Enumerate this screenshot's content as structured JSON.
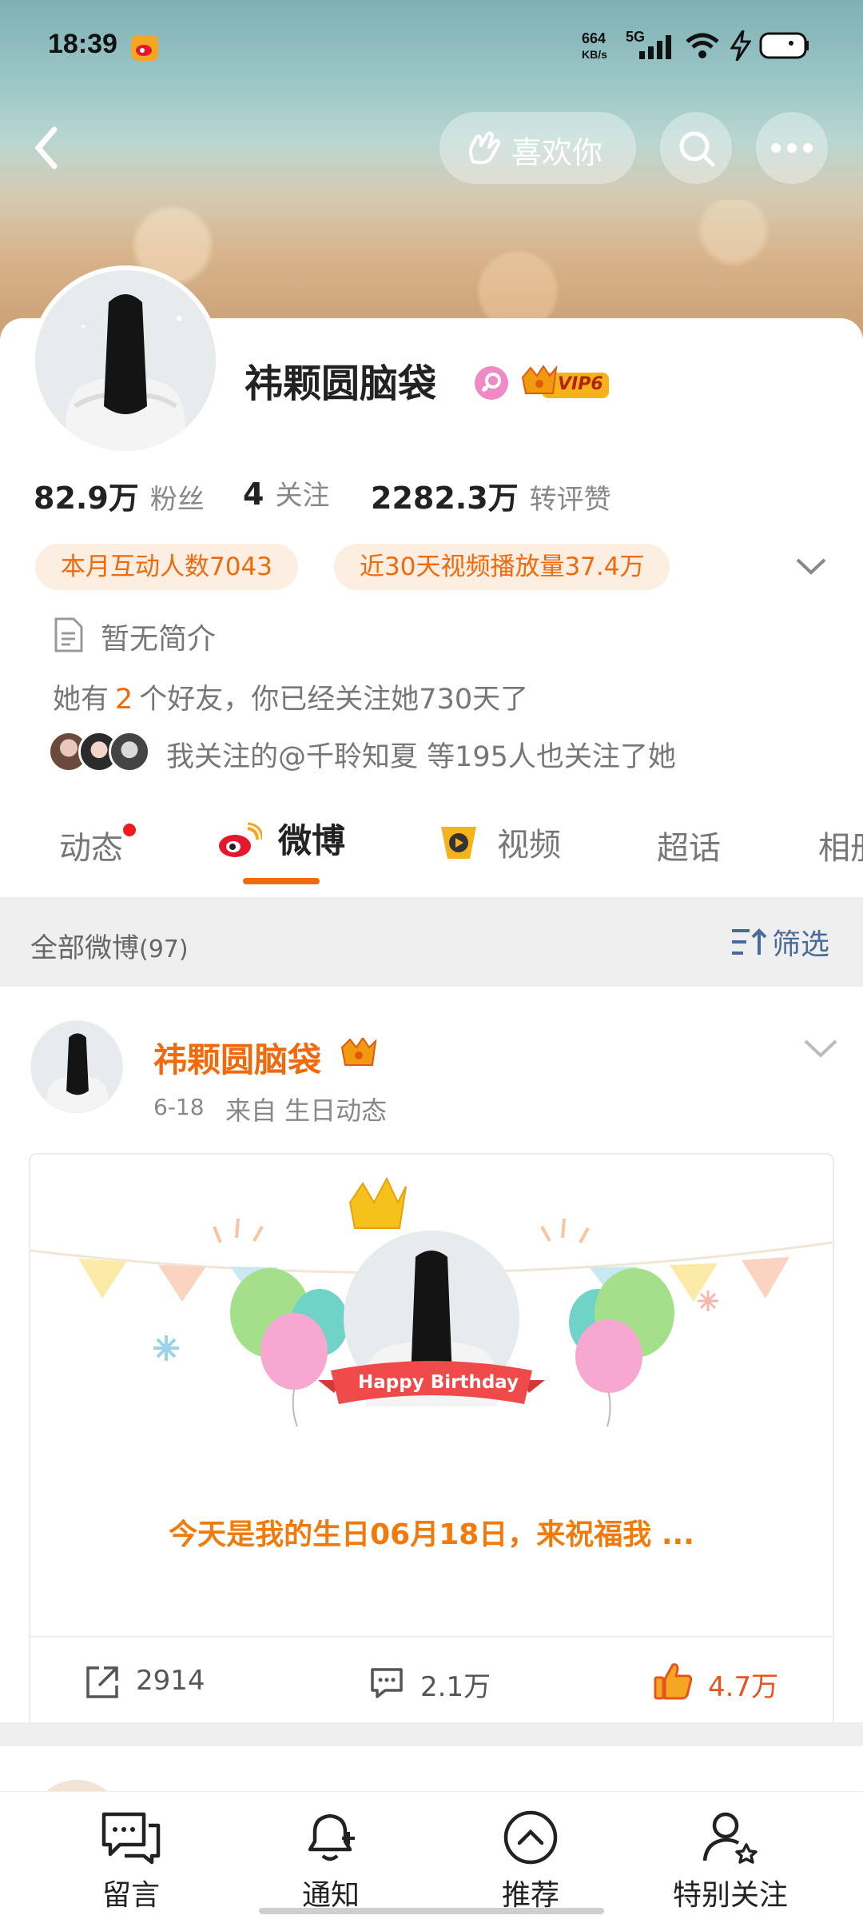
{
  "status_bar": {
    "time": "18:39",
    "net_speed_value": "664",
    "net_speed_unit": "KB/s",
    "network": "5G"
  },
  "header": {
    "like_label": "喜欢你"
  },
  "profile": {
    "name": "祎颗圆脑袋",
    "vip_label": "VIP6",
    "stats": [
      {
        "value": "82.9万",
        "label": "粉丝"
      },
      {
        "value": "4",
        "label": "关注"
      },
      {
        "value": "2282.3万",
        "label": "转评赞"
      }
    ],
    "chips": [
      "本月互动人数7043",
      "近30天视频播放量37.4万"
    ],
    "bio": "暂无简介",
    "friends_line": {
      "prefix": "她有",
      "count": "2",
      "suffix": "个好友，你已经关注她730天了"
    },
    "mutual": "我关注的@千聆知夏 等195人也关注了她"
  },
  "tabs": [
    {
      "label": "动态",
      "has_dot": true
    },
    {
      "label": "微博",
      "active": true
    },
    {
      "label": "视频"
    },
    {
      "label": "超话"
    },
    {
      "label": "相册"
    }
  ],
  "filter": {
    "title": "全部微博",
    "count": "(97)",
    "filter_label": "筛选"
  },
  "post": {
    "author": "祎颗圆脑袋",
    "date": "6-18",
    "source": "来自 生日动态",
    "card_banner": "Happy Birthday",
    "card_text": "今天是我的生日06月18日，来祝福我 ...",
    "reposts": "2914",
    "comments": "2.1万",
    "likes": "4.7万"
  },
  "bottom_nav": [
    {
      "label": "留言",
      "icon": "message-icon"
    },
    {
      "label": "通知",
      "icon": "bell-add-icon"
    },
    {
      "label": "推荐",
      "icon": "chevron-up-circle-icon"
    },
    {
      "label": "特别关注",
      "icon": "user-star-icon"
    }
  ],
  "colors": {
    "accent_orange": "#f06a0c",
    "link_blue": "#4a6b9a",
    "like_red": "#e8541e"
  }
}
